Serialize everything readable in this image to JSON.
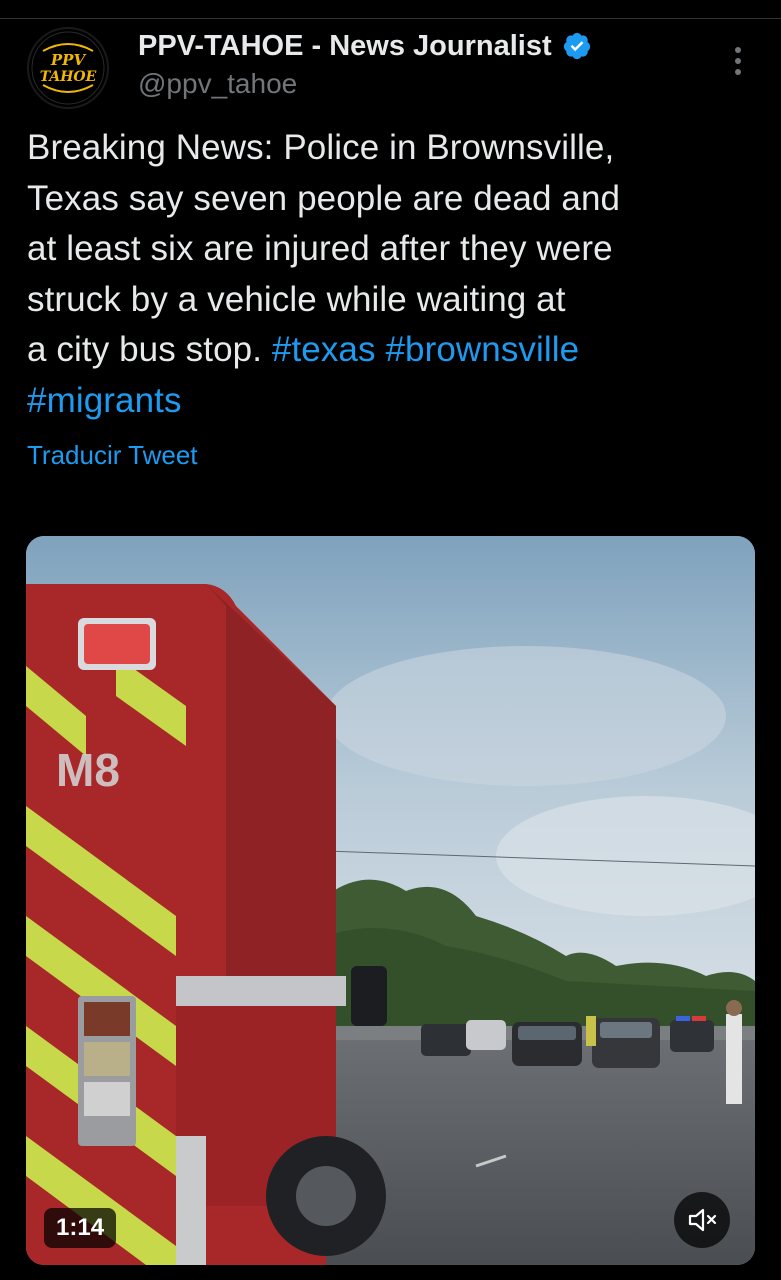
{
  "tweet": {
    "author": {
      "display_name": "PPV-TAHOE - News Journalist",
      "handle": "@ppv_tahoe",
      "avatar_text_line1": "PPV",
      "avatar_text_line2": "TAHOE",
      "verified": true
    },
    "text_segments": [
      {
        "type": "text",
        "value": "Breaking News: Police in Brownsville,"
      },
      {
        "type": "text",
        "value": "Texas say seven people are dead and"
      },
      {
        "type": "text",
        "value": "at least six are injured after they were"
      },
      {
        "type": "text",
        "value": "struck by a vehicle while waiting at"
      },
      {
        "type": "text",
        "value": "a city bus stop. "
      }
    ],
    "hashtags": [
      "#texas",
      "#brownsville",
      "#migrants"
    ],
    "translate_label": "Traducir Tweet",
    "video": {
      "duration": "1:14",
      "vehicle_marking": "M8",
      "muted": true
    }
  },
  "colors": {
    "background": "#000000",
    "text": "#e7e9ea",
    "secondary": "#71767b",
    "link": "#1d9bf0",
    "verified": "#1d9bf0"
  },
  "icons": [
    "more-vertical-icon",
    "verified-badge-icon",
    "mute-icon"
  ]
}
